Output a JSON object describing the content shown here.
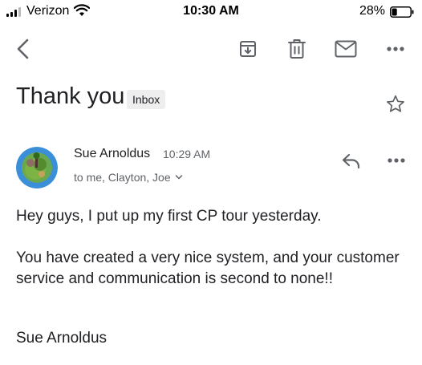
{
  "status_bar": {
    "carrier": "Verizon",
    "time": "10:30 AM",
    "battery_percent": "28%",
    "battery_level": 0.28,
    "signal_bars": 3,
    "signal_max": 4
  },
  "toolbar": {
    "back_icon": "chevron-left-icon",
    "archive_icon": "archive-icon",
    "delete_icon": "trash-icon",
    "mark_unread_icon": "mail-icon",
    "more_icon": "more-horiz-icon"
  },
  "email": {
    "subject": "Thank you",
    "label": "Inbox",
    "starred": false,
    "sender": "Sue Arnoldus",
    "time": "10:29 AM",
    "recipients": "to me, Clayton, Joe",
    "body": [
      "Hey guys, I put up my first CP tour yesterday.",
      "You have created a very nice system, and your customer service and communication is second to none!!",
      "Sue Arnoldus"
    ]
  },
  "colors": {
    "text": "#202124",
    "secondary": "#5f6368",
    "icon": "#5f6368",
    "chip_bg": "#eeeeee"
  }
}
